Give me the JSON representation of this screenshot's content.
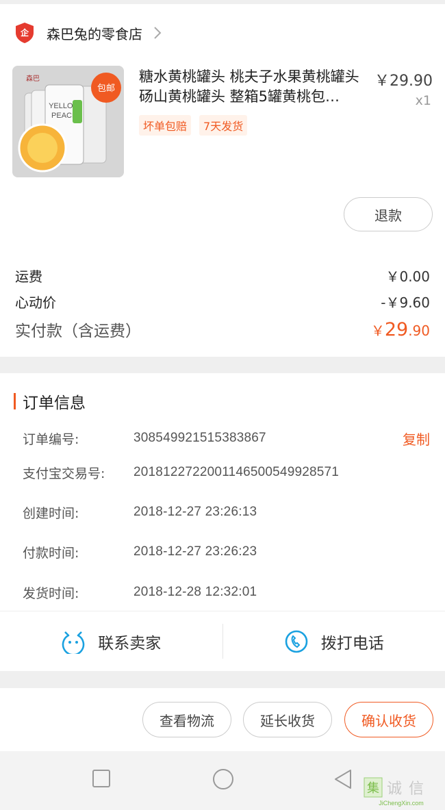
{
  "shop": {
    "name": "森巴兔的零食店",
    "icon": "shop-badge-icon"
  },
  "product": {
    "title": "糖水黄桃罐头 桃夫子水果黄桃罐头砀山黄桃罐头 整箱5罐黄桃包…",
    "price": "￥29.90",
    "qty": "x1",
    "image_text": "YELLOW PEACH",
    "image_badge": "包邮",
    "tags": [
      "坏单包赔",
      "7天发货"
    ]
  },
  "refund_label": "退款",
  "fees": {
    "shipping_label": "运费",
    "shipping_value": "￥0.00",
    "discount_label": "心动价",
    "discount_value": "-￥9.60",
    "total_label": "实付款（含运费）",
    "total_currency": "￥",
    "total_int": "29",
    "total_dec": ".90"
  },
  "order_info": {
    "title": "订单信息",
    "rows": [
      {
        "label": "订单编号:",
        "value": "308549921515383867"
      },
      {
        "label": "支付宝交易号:",
        "value": "2018122722001146500549928571"
      },
      {
        "label": "创建时间:",
        "value": "2018-12-27 23:26:13"
      },
      {
        "label": "付款时间:",
        "value": "2018-12-27 23:26:23"
      },
      {
        "label": "发货时间:",
        "value": "2018-12-28 12:32:01"
      }
    ],
    "copy_label": "复制"
  },
  "contact": {
    "seller_label": "联系卖家",
    "phone_label": "拨打电话"
  },
  "actions": {
    "logistics": "查看物流",
    "extend": "延长收货",
    "confirm": "确认收货"
  },
  "colors": {
    "accent": "#f05a22",
    "icon_blue": "#1aa1e0"
  },
  "watermark": {
    "text": "集诚信",
    "sub": "JiChengXin.com"
  }
}
